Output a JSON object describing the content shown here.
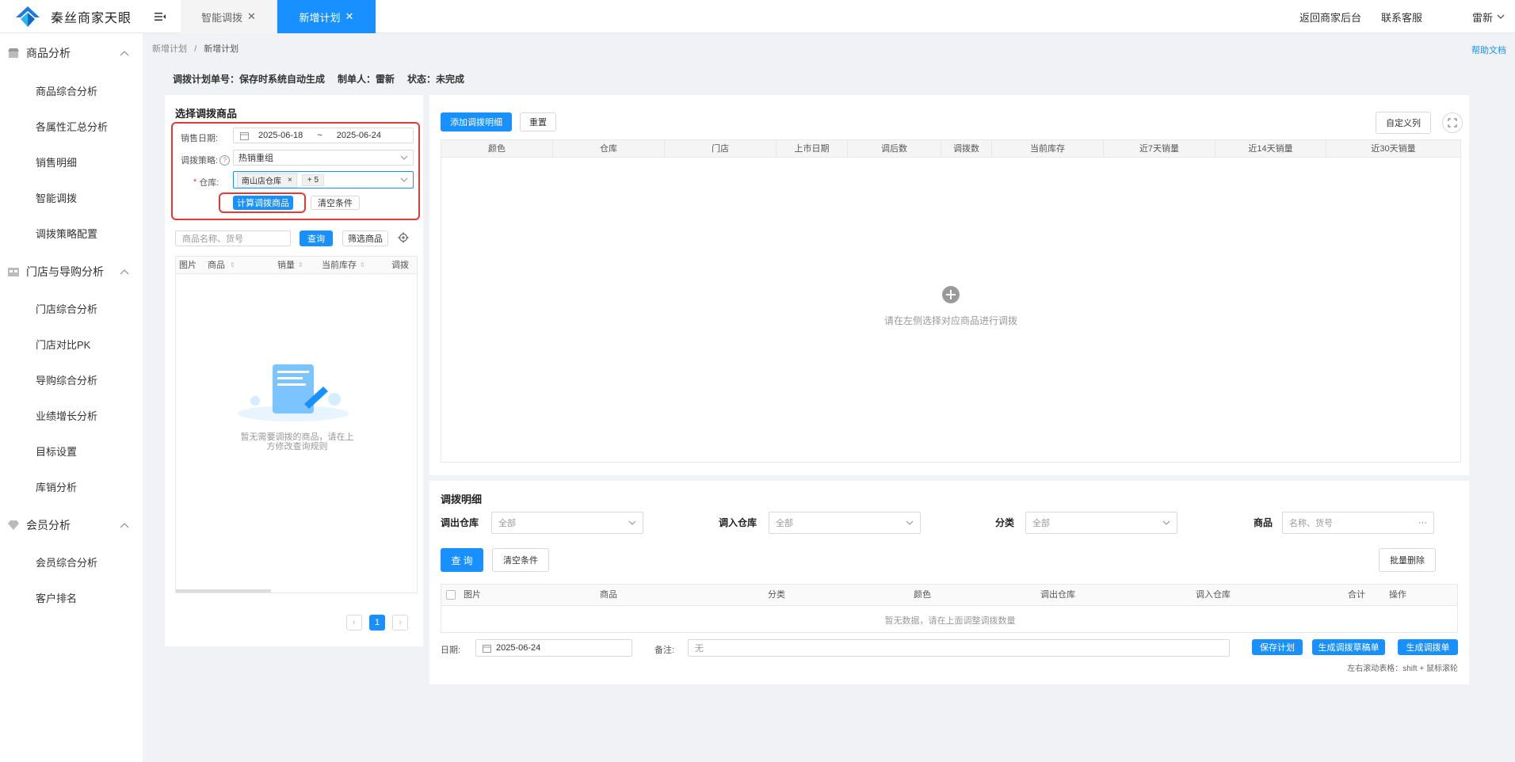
{
  "app": {
    "title": "秦丝商家天眼",
    "brand_color": "#1890ff"
  },
  "tabs": [
    {
      "label": "智能调拨",
      "close": "✕"
    },
    {
      "label": "新增计划",
      "close": "✕"
    }
  ],
  "topright": {
    "back": "返回商家后台",
    "contact": "联系客服",
    "user": "雷新"
  },
  "sidebar": {
    "groups": [
      {
        "label": "商品分析",
        "icon": "store-icon",
        "items": [
          "商品综合分析",
          "各属性汇总分析",
          "销售明细",
          "智能调拨",
          "调拨策略配置"
        ]
      },
      {
        "label": "门店与导购分析",
        "icon": "shop-icon",
        "items": [
          "门店综合分析",
          "门店对比PK",
          "导购综合分析",
          "业绩增长分析",
          "目标设置",
          "库销分析"
        ]
      },
      {
        "label": "会员分析",
        "icon": "diamond-icon",
        "items": [
          "会员综合分析",
          "客户排名"
        ]
      }
    ]
  },
  "breadcrumb": {
    "parent": "新增计划",
    "sep": "/",
    "current": "新增计划"
  },
  "help": "帮助文档",
  "plan": {
    "number": "调拨计划单号：保存时系统自动生成",
    "creator": "制单人：雷新",
    "status": "状态：未完成"
  },
  "left": {
    "title": "选择调拨商品",
    "date_label": "销售日期:",
    "date_start": "2025-06-18",
    "date_sep": "~",
    "date_end": "2025-06-24",
    "strategy_label": "调拨策略:",
    "strategy_value": "热销重组",
    "warehouse_label": "仓库:",
    "warehouse_required": "*",
    "warehouse_tag": "南山店仓库",
    "warehouse_tag_close": "×",
    "warehouse_more": "+ 5",
    "calc_button": "计算调拨商品",
    "clear_button": "清空条件",
    "search_placeholder": "商品名称、货号",
    "query_button": "查询",
    "filter_button": "筛选商品",
    "columns": [
      "图片",
      "商品",
      "销量",
      "当前库存",
      "调拨"
    ],
    "empty_line1": "暂无需要调拨的商品，请在上",
    "empty_line2": "方修改查询规则",
    "page": "1"
  },
  "right": {
    "add_button": "添加调拨明细",
    "reset_button": "重置",
    "custom_button": "自定义列",
    "columns": [
      "颜色",
      "仓库",
      "门店",
      "上市日期",
      "调后数",
      "调拨数",
      "当前库存",
      "近7天销量",
      "近14天销量",
      "近30天销量"
    ],
    "empty_text": "请在左侧选择对应商品进行调拨"
  },
  "detail": {
    "title": "调拨明细",
    "out_label": "调出仓库",
    "out_value": "全部",
    "in_label": "调入仓库",
    "in_value": "全部",
    "cat_label": "分类",
    "cat_value": "全部",
    "goods_label": "商品",
    "goods_placeholder": "名称、货号",
    "query_button": "查 询",
    "clear_button": "清空条件",
    "batch_delete": "批量删除",
    "columns": [
      "图片",
      "商品",
      "分类",
      "颜色",
      "调出仓库",
      "调入仓库",
      "合计",
      "操作"
    ],
    "empty_text": "暂无数据，请在上面调整调拨数量",
    "date_label": "日期:",
    "date_value": "2025-06-24",
    "note_label": "备注:",
    "note_placeholder": "无",
    "save_button": "保存计划",
    "draft_button": "生成调拨草稿单",
    "generate_button": "生成调拨单",
    "scroll_hint": "左右滚动表格：shift + 鼠标滚轮"
  }
}
